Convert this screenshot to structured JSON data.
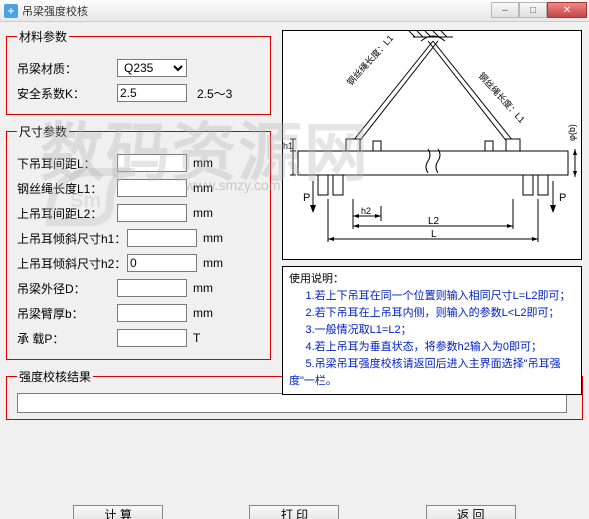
{
  "window": {
    "title": "吊梁强度校核",
    "icon_name": "app-icon"
  },
  "material": {
    "legend": "材料参数",
    "field_material_label": "吊梁材质：",
    "material_value": "Q235",
    "material_options": [
      "Q235"
    ],
    "field_k_label": "安全系数K：",
    "k_value": "2.5",
    "k_hint": "2.5～3"
  },
  "dimensions": {
    "legend": "尺寸参数",
    "l_label": "下吊耳间距L：",
    "l_value": "",
    "l_unit": "mm",
    "l1_label": "钢丝绳长度L1：",
    "l1_value": "",
    "l1_unit": "mm",
    "l2_label": "上吊耳间距L2：",
    "l2_value": "",
    "l2_unit": "mm",
    "h1_label": "上吊耳倾斜尺寸h1：",
    "h1_value": "",
    "h1_unit": "mm",
    "h2_label": "上吊耳倾斜尺寸h2：",
    "h2_value": "0",
    "h2_unit": "mm",
    "d_label": "吊梁外径D：",
    "d_value": "",
    "d_unit": "mm",
    "b_label": "吊梁臂厚b：",
    "b_value": "",
    "b_unit": "mm",
    "p_label": "承    载P：",
    "p_value": "",
    "p_unit": "T"
  },
  "instructions": {
    "heading": "使用说明：",
    "line1": "1.若上下吊耳在同一个位置则输入相同尺寸L=L2即可；",
    "line2": "2.若下吊耳在上吊耳内侧，则输入的参数L<L2即可；",
    "line3": "3.一般情况取L1=L2；",
    "line4": "4.若上吊耳为垂直状态，将参数h2输入为0即可；",
    "line5a": "5.吊梁吊耳强度校核请返回后进入主界面选择\"吊耳强",
    "line5b": "度\"一栏。"
  },
  "result": {
    "legend": "强度校核结果",
    "value": ""
  },
  "buttons": {
    "calc": "计  算",
    "print": "打  印",
    "back": "返  回"
  },
  "watermark": {
    "main": "数码资源网",
    "sub": "www.smzy.com"
  },
  "diagram_labels": {
    "rope_left": "钢丝绳长度：L1",
    "rope_right": "钢丝绳长度：L1",
    "L": "L",
    "L2": "L2",
    "h1": "h1",
    "h2": "h2",
    "P_left": "P",
    "P_right": "P",
    "phib": "φ(b)"
  }
}
